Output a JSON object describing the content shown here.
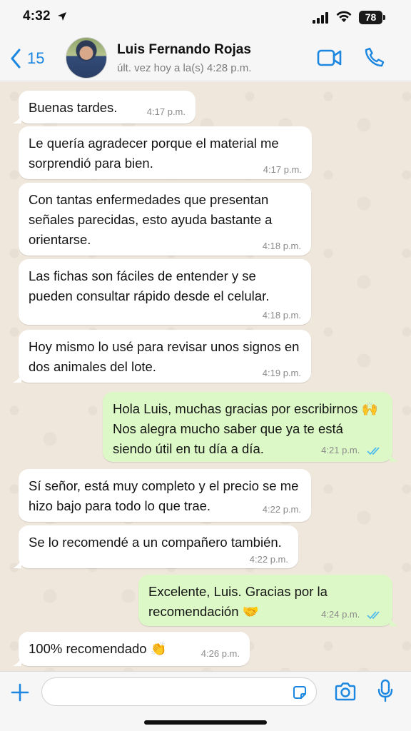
{
  "status_bar": {
    "time": "4:32",
    "battery": "78"
  },
  "header": {
    "back_count": "15",
    "contact_name": "Luis Fernando Rojas",
    "contact_status": "últ. vez hoy a la(s) 4:28 p.m."
  },
  "messages": [
    {
      "dir": "in",
      "text": "Buenas tardes.",
      "time": "4:17 p.m."
    },
    {
      "dir": "in",
      "text": "Le quería agradecer porque el material me sorprendió para bien.",
      "time": "4:17 p.m."
    },
    {
      "dir": "in",
      "text": "Con tantas enfermedades que presentan señales parecidas, esto ayuda bastante a orientarse.",
      "time": "4:18 p.m."
    },
    {
      "dir": "in",
      "text": "Las fichas son fáciles de entender y se pueden consultar rápido desde el celular.",
      "time": "4:18 p.m."
    },
    {
      "dir": "in",
      "text": "Hoy mismo lo usé para revisar unos signos en dos animales del lote.",
      "time": "4:19 p.m."
    },
    {
      "dir": "out",
      "text": "Hola Luis, muchas gracias por escribirnos 🙌 Nos alegra mucho saber que ya te está siendo útil en tu día a día.",
      "time": "4:21 p.m."
    },
    {
      "dir": "in",
      "text": "Sí señor, está muy completo y el precio se me hizo bajo para todo lo que trae.",
      "time": "4:22 p.m."
    },
    {
      "dir": "in",
      "text": "Se lo recomendé a un compañero también.",
      "time": "4:22 p.m."
    },
    {
      "dir": "out",
      "text": "Excelente, Luis. Gracias por la recomendación 🤝",
      "time": "4:24 p.m."
    },
    {
      "dir": "in",
      "text": "100% recomendado 👏",
      "time": "4:26 p.m."
    }
  ],
  "colors": {
    "accent": "#1b87e0",
    "incoming_bubble": "#ffffff",
    "outgoing_bubble": "#dcf8c6",
    "chat_background": "#efe7dc",
    "read_ticks": "#53bdeb"
  },
  "icons": {
    "back": "chevron-left-icon",
    "video": "video-camera-icon",
    "call": "phone-icon",
    "plus": "plus-icon",
    "sticker": "sticker-icon",
    "camera": "camera-icon",
    "mic": "microphone-icon"
  },
  "input": {
    "value": ""
  }
}
